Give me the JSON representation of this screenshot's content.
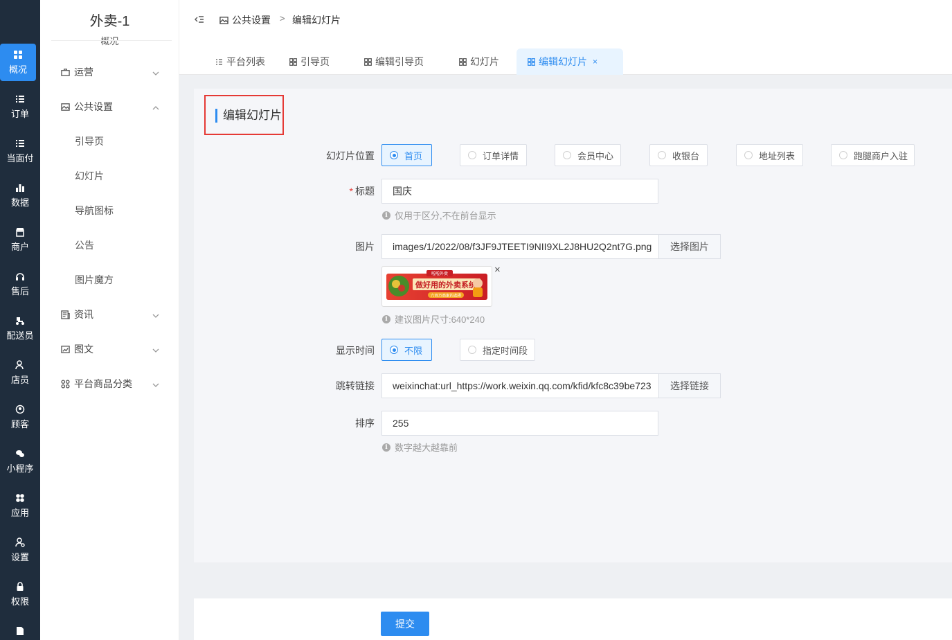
{
  "rail": [
    {
      "label": "概况",
      "icon": "grid-icon"
    },
    {
      "label": "订单",
      "icon": "list-icon"
    },
    {
      "label": "当面付",
      "icon": "list-icon"
    },
    {
      "label": "数据",
      "icon": "bar-chart-icon"
    },
    {
      "label": "商户",
      "icon": "store-icon"
    },
    {
      "label": "售后",
      "icon": "headset-icon"
    },
    {
      "label": "配送员",
      "icon": "scooter-icon"
    },
    {
      "label": "店员",
      "icon": "users-icon"
    },
    {
      "label": "顾客",
      "icon": "user-circle-icon"
    },
    {
      "label": "小程序",
      "icon": "wechat-icon"
    },
    {
      "label": "应用",
      "icon": "apps-icon"
    },
    {
      "label": "设置",
      "icon": "user-gear-icon"
    },
    {
      "label": "权限",
      "icon": "lock-icon"
    }
  ],
  "sidebar": {
    "title": "外卖-1",
    "subtitle": "概况",
    "menu": [
      {
        "label": "运营"
      },
      {
        "label": "公共设置"
      },
      {
        "label": "资讯"
      },
      {
        "label": "图文"
      },
      {
        "label": "平台商品分类"
      }
    ],
    "sub_items": [
      {
        "label": "引导页"
      },
      {
        "label": "幻灯片"
      },
      {
        "label": "导航图标"
      },
      {
        "label": "公告"
      },
      {
        "label": "图片魔方"
      }
    ]
  },
  "breadcrumb": {
    "root": "公共设置",
    "separator": ">",
    "current": "编辑幻灯片"
  },
  "tabs": [
    {
      "label": "平台列表"
    },
    {
      "label": "引导页"
    },
    {
      "label": "编辑引导页"
    },
    {
      "label": "幻灯片"
    },
    {
      "label": "编辑幻灯片",
      "close": "×"
    }
  ],
  "form": {
    "section_title": "编辑幻灯片",
    "position_label": "幻灯片位置",
    "positions": [
      {
        "label": "首页",
        "selected": true
      },
      {
        "label": "订单详情",
        "selected": false
      },
      {
        "label": "会员中心",
        "selected": false
      },
      {
        "label": "收银台",
        "selected": false
      },
      {
        "label": "地址列表",
        "selected": false
      },
      {
        "label": "跑腿商户入驻",
        "selected": false
      }
    ],
    "title_required": "*",
    "title_label": "标题",
    "title_value": "国庆",
    "title_hint": "仅用于区分,不在前台显示",
    "image_label": "图片",
    "image_value": "images/1/2022/08/f3JF9JTEETI9NII9XL2J8HU2Q2nt7G.png",
    "image_button": "选择图片",
    "image_remove": "×",
    "image_hint": "建议图片尺寸:640*240",
    "banner_text": {
      "brand": "啦啦外卖",
      "headline": "做好用的外卖系统",
      "sub": "六百万商家的选择"
    },
    "time_label": "显示时间",
    "times": [
      {
        "label": "不限",
        "selected": true
      },
      {
        "label": "指定时间段",
        "selected": false
      }
    ],
    "link_label": "跳转链接",
    "link_value": "weixinchat:url_https://work.weixin.qq.com/kfid/kfc8c39be723",
    "link_button": "选择链接",
    "sort_label": "排序",
    "sort_value": "255",
    "sort_hint": "数字越大越靠前",
    "hint_icon": "i",
    "submit": "提交"
  },
  "colors": {
    "rail": "#1f2d3d",
    "accent": "#2d8cf0",
    "highlight_box": "#e53935"
  }
}
